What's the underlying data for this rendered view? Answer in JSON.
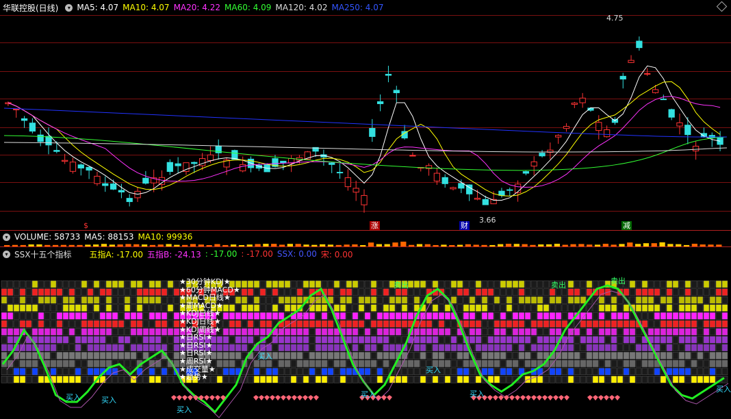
{
  "price_panel": {
    "title": "华联控股(日线)",
    "ma": [
      {
        "label": "MA5: 4.07",
        "color": "#ffffff"
      },
      {
        "label": "MA10: 4.07",
        "color": "#ffff00"
      },
      {
        "label": "MA20: 4.22",
        "color": "#ff00ff"
      },
      {
        "label": "MA60: 4.09",
        "color": "#00ff00"
      },
      {
        "label": "MA120: 4.02",
        "color": "#dddddd"
      },
      {
        "label": "MA250: 4.07",
        "color": "#0000ff"
      }
    ],
    "high_label": "4.75",
    "low_label": "3.66",
    "markers": [
      {
        "text": "$",
        "color": "#ff3333",
        "bg": "none"
      },
      {
        "text": "涨",
        "color": "#ffffff",
        "bg": "#aa0000"
      },
      {
        "text": "财",
        "color": "#ffffff",
        "bg": "#0000aa"
      },
      {
        "text": "减",
        "color": "#ffffff",
        "bg": "#006600"
      }
    ]
  },
  "volume_panel": {
    "title": "VOLUME: 58733",
    "ma5": "MA5: 88153",
    "ma10": "MA10: 99936"
  },
  "ssx_panel": {
    "title": "SSX十五个指标",
    "values": [
      {
        "label": "五指A: -17.00",
        "color": "#ffff00"
      },
      {
        "label": "五指B: -24.13",
        "color": "#ff00ff"
      },
      {
        "label": ": -17.00",
        "color": "#00ff00"
      },
      {
        "label": ": -17.00",
        "color": "#ff3333"
      },
      {
        "label": "SSX: 0.00",
        "color": "#3333ff"
      },
      {
        "label": "宋: 0.00",
        "color": "#ff3333"
      }
    ],
    "legend": [
      "★30分钟KDJ★",
      "★60分钟MACD★",
      "★MACD日线★",
      "★周MACD★",
      "★KDJ日线★",
      "★KDJ日线★",
      "★KDJ周线★",
      "★日RSI★",
      "★日RSI★",
      "★日RSI★",
      "★周RSI★",
      "★成交量★",
      "★趋势★"
    ],
    "buy_label": "买入",
    "sell_label": "卖出"
  }
}
